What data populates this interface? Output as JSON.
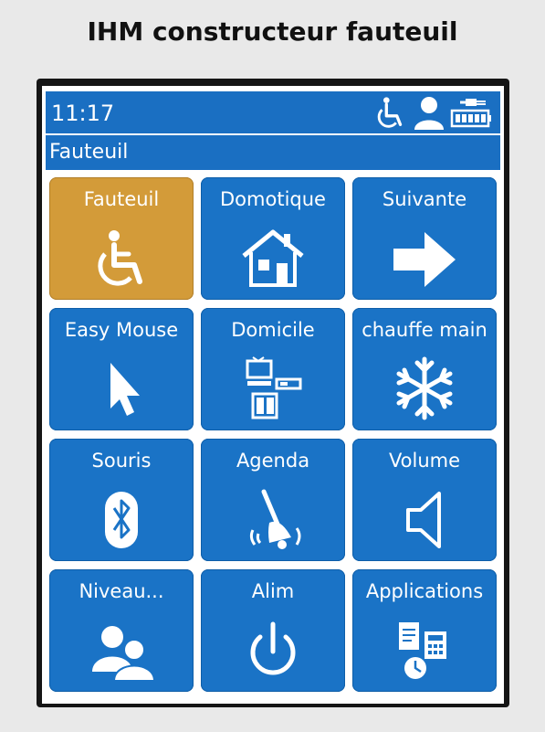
{
  "caption": "IHM constructeur fauteuil",
  "statusbar": {
    "time": "11:17",
    "icons": [
      "wheelchair-icon",
      "user-icon",
      "battery-plug-icon"
    ]
  },
  "titlebar": {
    "title": "Fauteuil"
  },
  "colors": {
    "tile": "#1a73c6",
    "tile_active": "#d39b39",
    "bar": "#1a6fc2"
  },
  "tiles": [
    {
      "label": "Fauteuil",
      "icon": "wheelchair-icon",
      "active": true
    },
    {
      "label": "Domotique",
      "icon": "house-icon",
      "active": false
    },
    {
      "label": "Suivante",
      "icon": "arrow-right-icon",
      "active": false
    },
    {
      "label": "Easy Mouse",
      "icon": "cursor-icon",
      "active": false
    },
    {
      "label": "Domicile",
      "icon": "devices-icon",
      "active": false
    },
    {
      "label": "chauffe main",
      "icon": "snowflake-icon",
      "active": false
    },
    {
      "label": "Souris",
      "icon": "bluetooth-icon",
      "active": false
    },
    {
      "label": "Agenda",
      "icon": "bell-icon",
      "active": false
    },
    {
      "label": "Volume",
      "icon": "speaker-icon",
      "active": false
    },
    {
      "label": "Niveau...",
      "icon": "users-icon",
      "active": false
    },
    {
      "label": "Alim",
      "icon": "power-icon",
      "active": false
    },
    {
      "label": "Applications",
      "icon": "apps-icon",
      "active": false
    }
  ]
}
